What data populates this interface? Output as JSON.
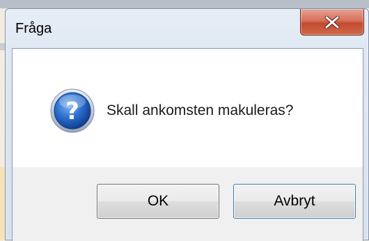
{
  "dialog": {
    "title": "Fråga",
    "message": "Skall ankomsten makuleras?",
    "icon": "question-icon",
    "close_icon": "close-icon",
    "buttons": {
      "ok_label": "OK",
      "cancel_label": "Avbryt"
    }
  },
  "colors": {
    "close_button": "#c24a30",
    "icon_blue": "#1e5db8",
    "button_area": "#f0f0f0",
    "default_button_border": "#3c7fb1"
  }
}
